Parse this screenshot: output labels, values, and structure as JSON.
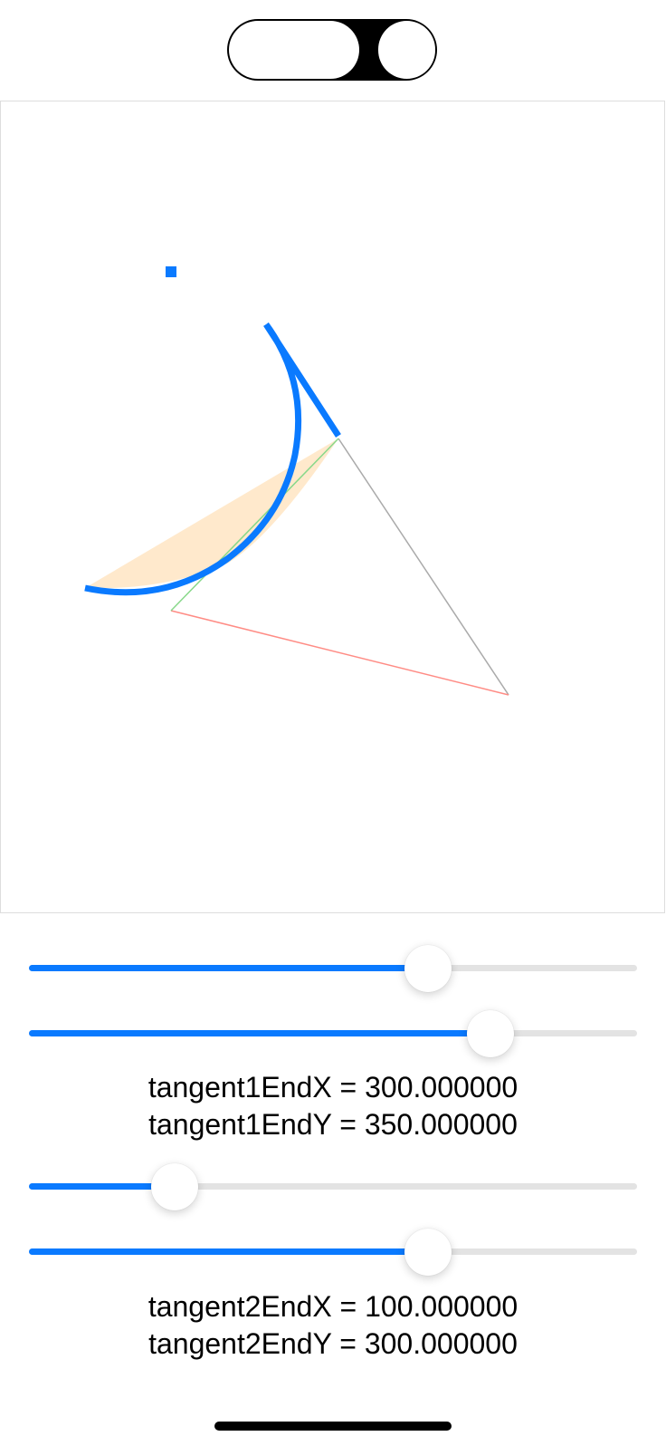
{
  "segmented_control": {
    "segments": [
      "",
      ""
    ],
    "selected_index": 1
  },
  "canvas": {
    "colors": {
      "arc": "#0a7aff",
      "fill": "#ffe9cc",
      "tangent1": "#aaaaaa",
      "tangent2": "#ff8c85",
      "chord": "#88d88a"
    }
  },
  "sliders": [
    {
      "name": "tangent1EndX",
      "fraction": 0.65
    },
    {
      "name": "tangent1EndY",
      "fraction": 0.76
    },
    {
      "name": "tangent2EndX",
      "fraction": 0.24
    },
    {
      "name": "tangent2EndY",
      "fraction": 0.65
    }
  ],
  "labels": {
    "tangent1EndX": "tangent1EndX = 300.000000",
    "tangent1EndY": "tangent1EndY = 350.000000",
    "tangent2EndX": "tangent2EndX = 100.000000",
    "tangent2EndY": "tangent2EndY = 300.000000"
  },
  "accent_color": "#0a7aff"
}
